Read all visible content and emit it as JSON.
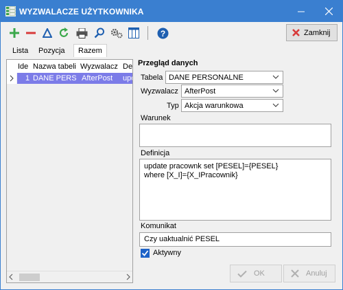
{
  "window": {
    "title": "WYZWALACZE UŻYTKOWNIKA",
    "title_bar_color": "#3a7fd0"
  },
  "toolbar": {
    "icons": [
      "add-icon",
      "remove-icon",
      "edit-triangle-icon",
      "refresh-icon",
      "print-icon",
      "search-icon",
      "settings-icon",
      "columns-icon",
      "help-icon"
    ],
    "close_label": "Zamknij"
  },
  "tabs": [
    {
      "label": "Lista",
      "active": false
    },
    {
      "label": "Pozycja",
      "active": false
    },
    {
      "label": "Razem",
      "active": true
    }
  ],
  "grid": {
    "columns": [
      "Ide",
      "Nazwa tabeli",
      "Wyzwalacz",
      "De"
    ],
    "rows": [
      {
        "id": "1",
        "table": "DANE PERSON",
        "trigger": "AfterPost",
        "def": "upd"
      }
    ],
    "selection_color": "#7c7ce8"
  },
  "panel": {
    "title": "Przegląd danych",
    "tabela_label": "Tabela",
    "tabela_value": "DANE PERSONALNE",
    "wyzwalacz_label": "Wyzwalacz",
    "wyzwalacz_value": "AfterPost",
    "typ_label": "Typ",
    "typ_value": "Akcja warunkowa",
    "warunek_label": "Warunek",
    "warunek_value": "",
    "definicja_label": "Definicja",
    "definicja_value": "update pracownk set [PESEL]={PESEL}\nwhere [X_I]={X_IPracownik}",
    "komunikat_label": "Komunikat",
    "komunikat_value": "Czy uaktualnić PESEL",
    "aktywny_label": "Aktywny",
    "aktywny_checked": true
  },
  "footer": {
    "ok_label": "OK",
    "cancel_label": "Anuluj"
  }
}
